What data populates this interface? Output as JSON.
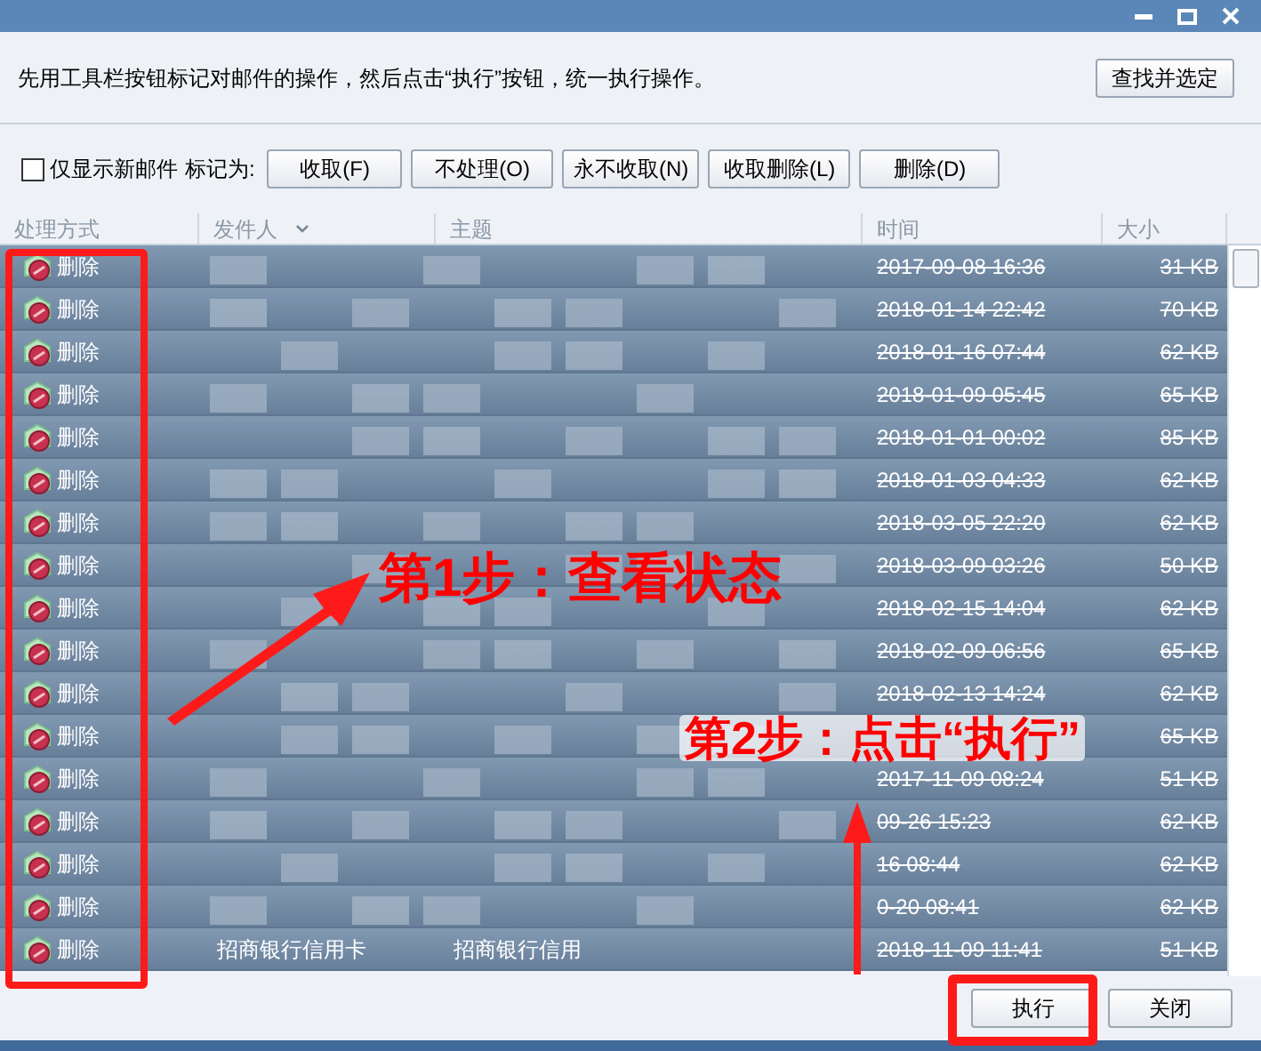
{
  "instruction": "先用工具栏按钮标记对邮件的操作，然后点击“执行”按钮，统一执行操作。",
  "find_button": "查找并选定",
  "toolbar": {
    "filter": {
      "label": "仅显示新邮件",
      "checked": false
    },
    "mark_label": "标记为:",
    "buttons": [
      "收取(F)",
      "不处理(O)",
      "永不收取(N)",
      "收取删除(L)",
      "删除(D)"
    ]
  },
  "table": {
    "columns": [
      "处理方式",
      "发件人",
      "主题",
      "时间",
      "大小"
    ],
    "rows": [
      {
        "action": "删除",
        "time": "2017-09-08 16:36",
        "size": "31 KB"
      },
      {
        "action": "删除",
        "time": "2018-01-14 22:42",
        "size": "70 KB"
      },
      {
        "action": "删除",
        "time": "2018-01-16 07:44",
        "size": "62 KB"
      },
      {
        "action": "删除",
        "time": "2018-01-09 05:45",
        "size": "65 KB"
      },
      {
        "action": "删除",
        "time": "2018-01-01 00:02",
        "size": "85 KB"
      },
      {
        "action": "删除",
        "time": "2018-01-03 04:33",
        "size": "62 KB"
      },
      {
        "action": "删除",
        "time": "2018-03-05 22:20",
        "size": "62 KB"
      },
      {
        "action": "删除",
        "time": "2018-03-09 03:26",
        "size": "50 KB"
      },
      {
        "action": "删除",
        "time": "2018-02-15 14:04",
        "size": "62 KB"
      },
      {
        "action": "删除",
        "time": "2018-02-09 06:56",
        "size": "65 KB"
      },
      {
        "action": "删除",
        "time": "2018-02-13 14:24",
        "size": "62 KB"
      },
      {
        "action": "删除",
        "size": "65 KB"
      },
      {
        "action": "删除",
        "time": "2017-11-09 08:24",
        "size": "51 KB"
      },
      {
        "action": "删除",
        "time": "09-26 15:23",
        "size": "62 KB"
      },
      {
        "action": "删除",
        "time": "16 08:44",
        "size": "62 KB"
      },
      {
        "action": "删除",
        "time": "0-20 08:41",
        "size": "62 KB"
      },
      {
        "action": "删除",
        "sender": "招商银行信用卡",
        "subject": "招商银行信用",
        "time": "2018-11-09 11:41",
        "size": "51 KB"
      }
    ]
  },
  "footer_buttons": [
    "执行",
    "关闭"
  ],
  "annotations": [
    "第1步：查看状态",
    "第2步：点击“执行”"
  ]
}
